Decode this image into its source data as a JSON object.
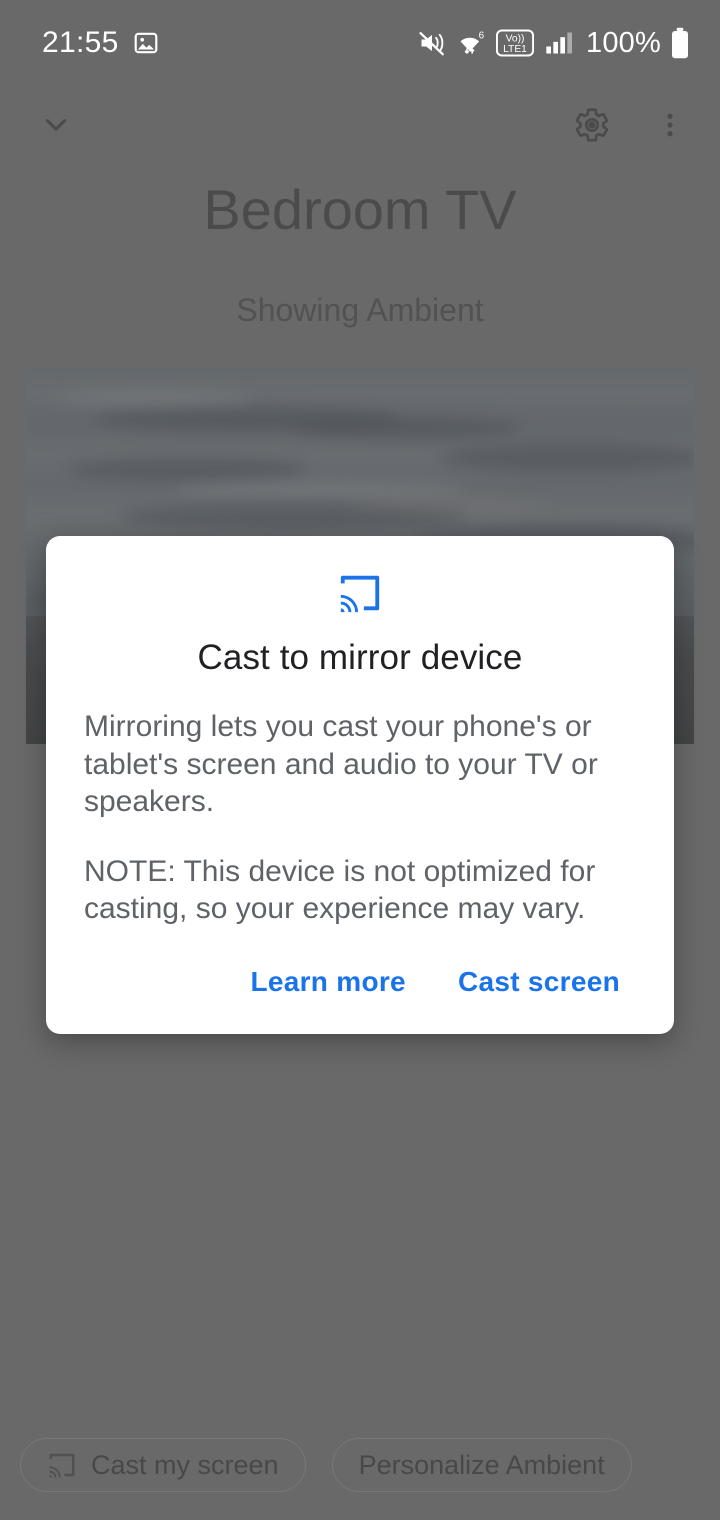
{
  "status_bar": {
    "time": "21:55",
    "battery_percent": "100%",
    "icons": [
      "photo-notification-icon",
      "mute-vibrate-icon",
      "wifi-6-icon",
      "volte-lte1-icon",
      "cellular-signal-icon",
      "battery-icon"
    ],
    "wifi_label": "6",
    "volte_label_top": "Vo))",
    "volte_label_bottom": "LTE1"
  },
  "app_bar": {
    "collapse_icon": "chevron-down-icon",
    "settings_icon": "gear-icon",
    "overflow_icon": "more-vert-icon"
  },
  "device": {
    "name": "Bedroom TV",
    "status": "Showing Ambient"
  },
  "chips": [
    {
      "label": "Cast my screen",
      "icon": "cast-icon"
    },
    {
      "label": "Personalize Ambient",
      "icon": ""
    }
  ],
  "dialog": {
    "icon": "cast-icon",
    "title": "Cast to mirror device",
    "body1": "Mirroring lets you cast your phone's or tablet's screen and audio to your TV or speakers.",
    "body2": "NOTE: This device is not optimized for casting, so your experience may vary.",
    "learn_more_label": "Learn more",
    "cast_screen_label": "Cast screen"
  },
  "colors": {
    "scrim": "#696969",
    "accent_blue": "#1a73e8",
    "dialog_bg": "#ffffff",
    "title_text": "#1b1b1b",
    "body_text": "#5f6368"
  }
}
